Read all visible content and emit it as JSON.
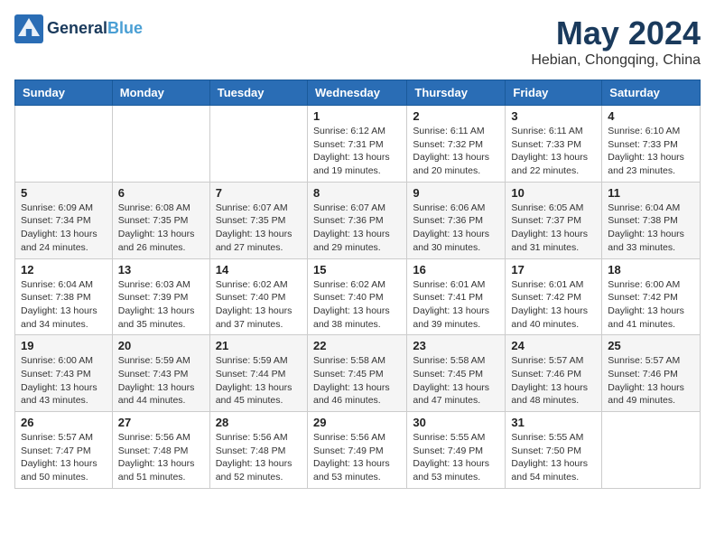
{
  "header": {
    "logo_line1": "General",
    "logo_line2": "Blue",
    "month": "May 2024",
    "location": "Hebian, Chongqing, China"
  },
  "days_of_week": [
    "Sunday",
    "Monday",
    "Tuesday",
    "Wednesday",
    "Thursday",
    "Friday",
    "Saturday"
  ],
  "weeks": [
    [
      {
        "day": "",
        "info": ""
      },
      {
        "day": "",
        "info": ""
      },
      {
        "day": "",
        "info": ""
      },
      {
        "day": "1",
        "info": "Sunrise: 6:12 AM\nSunset: 7:31 PM\nDaylight: 13 hours and 19 minutes."
      },
      {
        "day": "2",
        "info": "Sunrise: 6:11 AM\nSunset: 7:32 PM\nDaylight: 13 hours and 20 minutes."
      },
      {
        "day": "3",
        "info": "Sunrise: 6:11 AM\nSunset: 7:33 PM\nDaylight: 13 hours and 22 minutes."
      },
      {
        "day": "4",
        "info": "Sunrise: 6:10 AM\nSunset: 7:33 PM\nDaylight: 13 hours and 23 minutes."
      }
    ],
    [
      {
        "day": "5",
        "info": "Sunrise: 6:09 AM\nSunset: 7:34 PM\nDaylight: 13 hours and 24 minutes."
      },
      {
        "day": "6",
        "info": "Sunrise: 6:08 AM\nSunset: 7:35 PM\nDaylight: 13 hours and 26 minutes."
      },
      {
        "day": "7",
        "info": "Sunrise: 6:07 AM\nSunset: 7:35 PM\nDaylight: 13 hours and 27 minutes."
      },
      {
        "day": "8",
        "info": "Sunrise: 6:07 AM\nSunset: 7:36 PM\nDaylight: 13 hours and 29 minutes."
      },
      {
        "day": "9",
        "info": "Sunrise: 6:06 AM\nSunset: 7:36 PM\nDaylight: 13 hours and 30 minutes."
      },
      {
        "day": "10",
        "info": "Sunrise: 6:05 AM\nSunset: 7:37 PM\nDaylight: 13 hours and 31 minutes."
      },
      {
        "day": "11",
        "info": "Sunrise: 6:04 AM\nSunset: 7:38 PM\nDaylight: 13 hours and 33 minutes."
      }
    ],
    [
      {
        "day": "12",
        "info": "Sunrise: 6:04 AM\nSunset: 7:38 PM\nDaylight: 13 hours and 34 minutes."
      },
      {
        "day": "13",
        "info": "Sunrise: 6:03 AM\nSunset: 7:39 PM\nDaylight: 13 hours and 35 minutes."
      },
      {
        "day": "14",
        "info": "Sunrise: 6:02 AM\nSunset: 7:40 PM\nDaylight: 13 hours and 37 minutes."
      },
      {
        "day": "15",
        "info": "Sunrise: 6:02 AM\nSunset: 7:40 PM\nDaylight: 13 hours and 38 minutes."
      },
      {
        "day": "16",
        "info": "Sunrise: 6:01 AM\nSunset: 7:41 PM\nDaylight: 13 hours and 39 minutes."
      },
      {
        "day": "17",
        "info": "Sunrise: 6:01 AM\nSunset: 7:42 PM\nDaylight: 13 hours and 40 minutes."
      },
      {
        "day": "18",
        "info": "Sunrise: 6:00 AM\nSunset: 7:42 PM\nDaylight: 13 hours and 41 minutes."
      }
    ],
    [
      {
        "day": "19",
        "info": "Sunrise: 6:00 AM\nSunset: 7:43 PM\nDaylight: 13 hours and 43 minutes."
      },
      {
        "day": "20",
        "info": "Sunrise: 5:59 AM\nSunset: 7:43 PM\nDaylight: 13 hours and 44 minutes."
      },
      {
        "day": "21",
        "info": "Sunrise: 5:59 AM\nSunset: 7:44 PM\nDaylight: 13 hours and 45 minutes."
      },
      {
        "day": "22",
        "info": "Sunrise: 5:58 AM\nSunset: 7:45 PM\nDaylight: 13 hours and 46 minutes."
      },
      {
        "day": "23",
        "info": "Sunrise: 5:58 AM\nSunset: 7:45 PM\nDaylight: 13 hours and 47 minutes."
      },
      {
        "day": "24",
        "info": "Sunrise: 5:57 AM\nSunset: 7:46 PM\nDaylight: 13 hours and 48 minutes."
      },
      {
        "day": "25",
        "info": "Sunrise: 5:57 AM\nSunset: 7:46 PM\nDaylight: 13 hours and 49 minutes."
      }
    ],
    [
      {
        "day": "26",
        "info": "Sunrise: 5:57 AM\nSunset: 7:47 PM\nDaylight: 13 hours and 50 minutes."
      },
      {
        "day": "27",
        "info": "Sunrise: 5:56 AM\nSunset: 7:48 PM\nDaylight: 13 hours and 51 minutes."
      },
      {
        "day": "28",
        "info": "Sunrise: 5:56 AM\nSunset: 7:48 PM\nDaylight: 13 hours and 52 minutes."
      },
      {
        "day": "29",
        "info": "Sunrise: 5:56 AM\nSunset: 7:49 PM\nDaylight: 13 hours and 53 minutes."
      },
      {
        "day": "30",
        "info": "Sunrise: 5:55 AM\nSunset: 7:49 PM\nDaylight: 13 hours and 53 minutes."
      },
      {
        "day": "31",
        "info": "Sunrise: 5:55 AM\nSunset: 7:50 PM\nDaylight: 13 hours and 54 minutes."
      },
      {
        "day": "",
        "info": ""
      }
    ]
  ]
}
